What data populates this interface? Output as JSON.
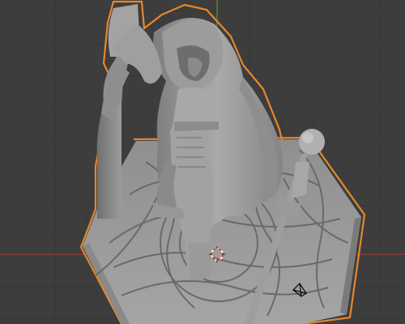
{
  "viewport": {
    "background": "#3d3d3d",
    "grid_color": "#353535",
    "grid_major_color": "#2f2f2f",
    "axis_x_color": "#9a3b3b",
    "axis_y_color": "#5f8a2a",
    "selection_outline_color": "#e8872a",
    "mesh_color": "#a9a9a9",
    "mesh_shadow_color": "#6f6f6f"
  },
  "scene": {
    "selected_object": "hooded-figure-miniature-with-staff",
    "base_shape": "hexagon",
    "engraving": "celtic-knot-pattern"
  },
  "overlays": {
    "cursor_3d": "3d-cursor-icon",
    "light_gizmo": "light-icon"
  }
}
